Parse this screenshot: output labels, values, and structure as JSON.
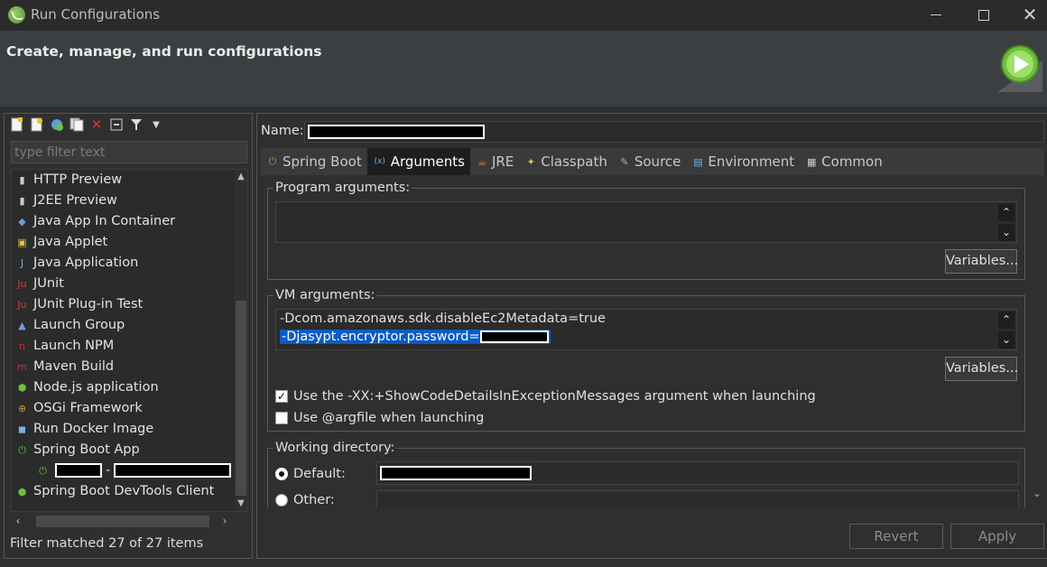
{
  "window": {
    "title": "Run Configurations",
    "minimize": "—",
    "maximize": "□",
    "close": "✕"
  },
  "header": {
    "title": "Create, manage, and run configurations"
  },
  "left": {
    "toolbar_icons": [
      "new-config-icon",
      "new-prototype-icon",
      "export-icon",
      "duplicate-icon",
      "delete-icon",
      "collapse-all-icon",
      "filter-icon",
      "dropdown-icon"
    ],
    "filter_placeholder": "type filter text",
    "tree": [
      {
        "label": "HTTP Preview",
        "icon": "http-preview-icon"
      },
      {
        "label": "J2EE Preview",
        "icon": "j2ee-preview-icon"
      },
      {
        "label": "Java App In Container",
        "icon": "java-container-icon"
      },
      {
        "label": "Java Applet",
        "icon": "java-applet-icon"
      },
      {
        "label": "Java Application",
        "icon": "java-application-icon"
      },
      {
        "label": "JUnit",
        "icon": "junit-icon"
      },
      {
        "label": "JUnit Plug-in Test",
        "icon": "junit-plugin-icon"
      },
      {
        "label": "Launch Group",
        "icon": "launch-group-icon"
      },
      {
        "label": "Launch NPM",
        "icon": "npm-icon"
      },
      {
        "label": "Maven Build",
        "icon": "maven-icon"
      },
      {
        "label": "Node.js application",
        "icon": "nodejs-icon"
      },
      {
        "label": "OSGi Framework",
        "icon": "osgi-icon"
      },
      {
        "label": "Run Docker Image",
        "icon": "docker-icon"
      },
      {
        "label": "Spring Boot App",
        "icon": "spring-boot-icon"
      },
      {
        "label": "-",
        "icon": "spring-boot-child-icon",
        "child": true
      },
      {
        "label": "Spring Boot DevTools Client",
        "icon": "spring-devtools-icon"
      }
    ],
    "filter_status": "Filter matched 27 of 27 items"
  },
  "right": {
    "name_label": "Name:",
    "tabs": [
      {
        "label": "Spring Boot",
        "icon": "spring-boot-icon"
      },
      {
        "label": "Arguments",
        "icon": "arguments-icon",
        "active": true
      },
      {
        "label": "JRE",
        "icon": "jre-icon"
      },
      {
        "label": "Classpath",
        "icon": "classpath-icon"
      },
      {
        "label": "Source",
        "icon": "source-icon"
      },
      {
        "label": "Environment",
        "icon": "environment-icon"
      },
      {
        "label": "Common",
        "icon": "common-icon"
      }
    ],
    "program_args": {
      "title": "Program arguments:",
      "value": "",
      "variables_button": "Variables..."
    },
    "vm_args": {
      "title": "VM arguments:",
      "line1": "-Dcom.amazonaws.sdk.disableEc2Metadata=true",
      "line2": "-Djasypt.encryptor.password=",
      "variables_button": "Variables...",
      "checkbox1_label": "Use the -XX:+ShowCodeDetailsInExceptionMessages argument when launching",
      "checkbox1_checked": true,
      "checkbox2_label": "Use @argfile when launching",
      "checkbox2_checked": false
    },
    "working_dir": {
      "title": "Working directory:",
      "default_label": "Default:",
      "other_label": "Other:"
    },
    "buttons": {
      "revert": "Revert",
      "apply": "Apply"
    }
  }
}
